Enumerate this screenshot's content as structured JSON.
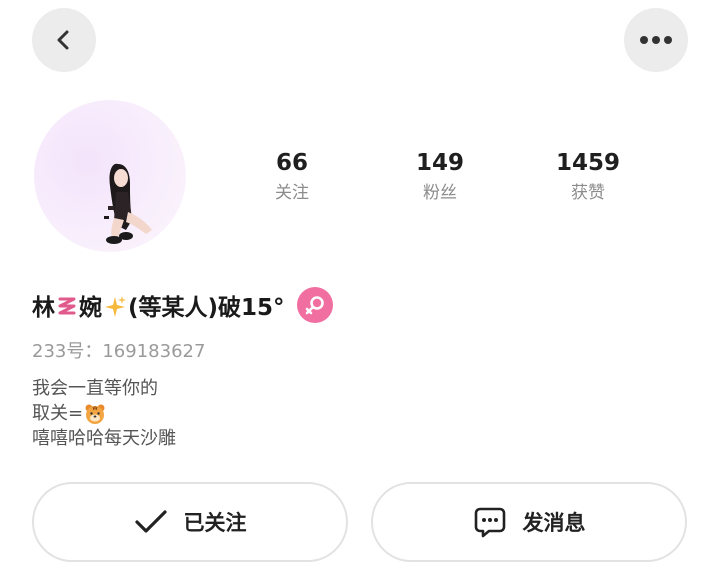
{
  "header": {
    "back_icon": "chevron-left-icon",
    "more_icon": "ellipsis-horizontal-icon"
  },
  "profile": {
    "avatar_description_icon": "avatar-image",
    "name": "林〰婉✨(等某人)破15°",
    "name_parts": {
      "a": "林",
      "b": "婉",
      "c": "(等某人)破15°"
    },
    "gender": "female",
    "gender_color": "#f06ea0",
    "uid_label": "233号：",
    "uid_value": "169183627",
    "bio": {
      "line1": "我会一直等你的",
      "line2_prefix": "取关=",
      "line2_emoji": "tiger-face-icon",
      "line3": "嘻嘻哈哈每天沙雕"
    }
  },
  "stats": {
    "following": {
      "value": "66",
      "label": "关注"
    },
    "fans": {
      "value": "149",
      "label": "粉丝"
    },
    "likes": {
      "value": "1459",
      "label": "获赞"
    }
  },
  "actions": {
    "follow": {
      "label": "已关注",
      "icon": "check-icon"
    },
    "message": {
      "label": "发消息",
      "icon": "chat-bubble-icon"
    }
  }
}
